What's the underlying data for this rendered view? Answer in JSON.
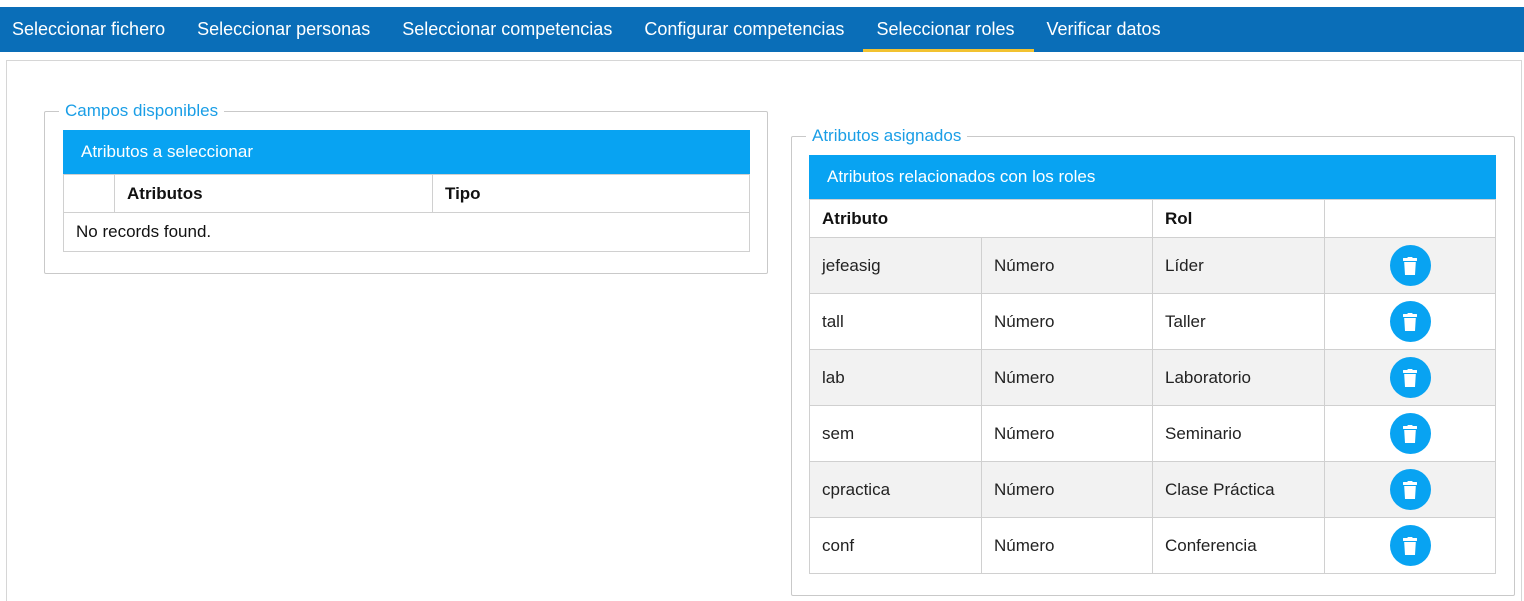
{
  "tabs": [
    {
      "label": "Seleccionar fichero",
      "active": false
    },
    {
      "label": "Seleccionar personas",
      "active": false
    },
    {
      "label": "Seleccionar competencias",
      "active": false
    },
    {
      "label": "Configurar competencias",
      "active": false
    },
    {
      "label": "Seleccionar roles",
      "active": true
    },
    {
      "label": "Verificar datos",
      "active": false
    }
  ],
  "left_panel": {
    "legend": "Campos disponibles",
    "header": "Atributos a seleccionar",
    "columns": [
      "",
      "Atributos",
      "Tipo"
    ],
    "empty_message": "No records found."
  },
  "right_panel": {
    "legend": "Atributos asignados",
    "header": "Atributos relacionados con los roles",
    "columns": [
      "Atributo",
      "Rol",
      ""
    ],
    "rows": [
      {
        "atributo": "jefeasig",
        "tipo": "Número",
        "rol": "Líder"
      },
      {
        "atributo": "tall",
        "tipo": "Número",
        "rol": "Taller"
      },
      {
        "atributo": "lab",
        "tipo": "Número",
        "rol": "Laboratorio"
      },
      {
        "atributo": "sem",
        "tipo": "Número",
        "rol": "Seminario"
      },
      {
        "atributo": "cpractica",
        "tipo": "Número",
        "rol": "Clase Práctica"
      },
      {
        "atributo": "conf",
        "tipo": "Número",
        "rol": "Conferencia"
      }
    ],
    "row_action_icon": "trash-icon"
  },
  "colors": {
    "tabbar": "#0a6eb8",
    "tab_active_underline": "#f2c230",
    "panel_header": "#08a3f2",
    "legend_text": "#1a9ee6"
  }
}
